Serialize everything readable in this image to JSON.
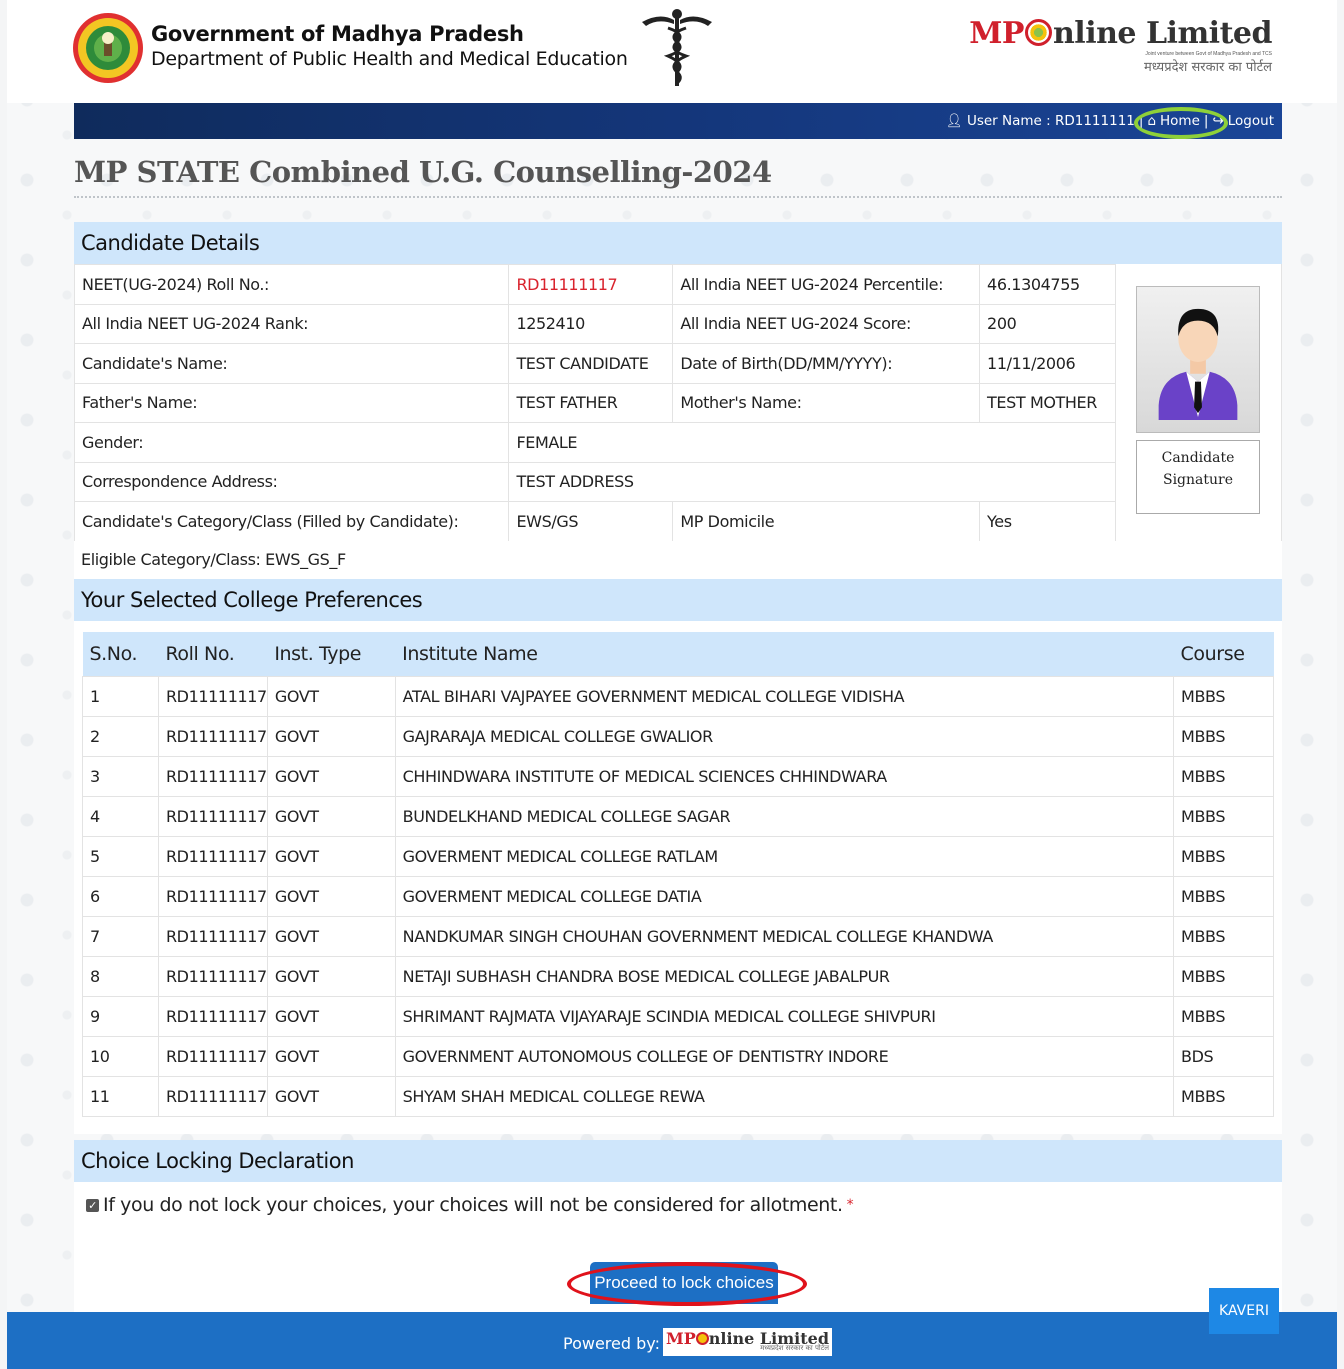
{
  "header": {
    "gov_title": "Government of Madhya Pradesh",
    "dept": "Department of Public Health and Medical Education",
    "mponline_brand_mp": "MP",
    "mponline_brand_rest": "nline Limited",
    "mponline_sub1": "Joint venture between Govt of Madhya Pradesh and TCS",
    "mponline_sub2": "मध्यप्रदेश सरकार का पोर्टल"
  },
  "topbar": {
    "user_label": "User Name : RD1111111",
    "home": "Home",
    "logout": "Logout",
    "separator": "|"
  },
  "page_title": "MP STATE Combined U.G. Counselling-2024",
  "candidate": {
    "heading": "Candidate Details",
    "roll_label": "NEET(UG-2024) Roll No.:",
    "roll_value": "RD11111117",
    "percentile_label": "All India NEET UG-2024 Percentile:",
    "percentile_value": "46.1304755",
    "rank_label": "All India NEET UG-2024 Rank:",
    "rank_value": "1252410",
    "score_label": "All India NEET UG-2024 Score:",
    "score_value": "200",
    "name_label": "Candidate's Name:",
    "name_value": "TEST CANDIDATE",
    "dob_label": "Date of Birth(DD/MM/YYYY):",
    "dob_value": "11/11/2006",
    "father_label": "Father's Name:",
    "father_value": "TEST FATHER",
    "mother_label": "Mother's Name:",
    "mother_value": "TEST MOTHER",
    "gender_label": "Gender:",
    "gender_value": "FEMALE",
    "address_label": "Correspondence Address:",
    "address_value": "TEST ADDRESS",
    "category_label": "Candidate's Category/Class (Filled by Candidate):",
    "category_value": "EWS/GS",
    "domicile_label": "MP Domicile",
    "domicile_value": "Yes",
    "eligible": "Eligible Category/Class: EWS_GS_F",
    "signature_line1": "Candidate",
    "signature_line2": "Signature"
  },
  "preferences": {
    "heading": "Your Selected College Preferences",
    "columns": [
      "S.No.",
      "Roll No.",
      "Inst. Type",
      "Institute Name",
      "Course"
    ],
    "rows": [
      [
        "1",
        "RD11111117",
        "GOVT",
        "ATAL BIHARI VAJPAYEE GOVERNMENT MEDICAL COLLEGE VIDISHA",
        "MBBS"
      ],
      [
        "2",
        "RD11111117",
        "GOVT",
        "GAJRARAJA MEDICAL COLLEGE GWALIOR",
        "MBBS"
      ],
      [
        "3",
        "RD11111117",
        "GOVT",
        "CHHINDWARA INSTITUTE OF MEDICAL SCIENCES CHHINDWARA",
        "MBBS"
      ],
      [
        "4",
        "RD11111117",
        "GOVT",
        "BUNDELKHAND MEDICAL COLLEGE SAGAR",
        "MBBS"
      ],
      [
        "5",
        "RD11111117",
        "GOVT",
        "GOVERMENT MEDICAL COLLEGE RATLAM",
        "MBBS"
      ],
      [
        "6",
        "RD11111117",
        "GOVT",
        "GOVERMENT MEDICAL COLLEGE DATIA",
        "MBBS"
      ],
      [
        "7",
        "RD11111117",
        "GOVT",
        "NANDKUMAR SINGH CHOUHAN GOVERNMENT MEDICAL COLLEGE KHANDWA",
        "MBBS"
      ],
      [
        "8",
        "RD11111117",
        "GOVT",
        "NETAJI SUBHASH CHANDRA BOSE MEDICAL COLLEGE JABALPUR",
        "MBBS"
      ],
      [
        "9",
        "RD11111117",
        "GOVT",
        "SHRIMANT RAJMATA VIJAYARAJE SCINDIA MEDICAL COLLEGE SHIVPURI",
        "MBBS"
      ],
      [
        "10",
        "RD11111117",
        "GOVT",
        "GOVERNMENT AUTONOMOUS COLLEGE OF DENTISTRY INDORE",
        "BDS"
      ],
      [
        "11",
        "RD11111117",
        "GOVT",
        "SHYAM SHAH MEDICAL COLLEGE REWA",
        "MBBS"
      ]
    ]
  },
  "declaration": {
    "heading": "Choice Locking Declaration",
    "text": "If you do not lock your choices, your choices will not be considered for allotment.",
    "required_mark": "*",
    "checked": true,
    "button": "Proceed to lock choices"
  },
  "footer": {
    "powered": "Powered by:",
    "logo_mp": "MP",
    "logo_rest": "nline Limited",
    "logo_sub": "मध्यप्रदेश सरकार का पोर्टल"
  },
  "kaveri": "KAVERI",
  "colors": {
    "navy": "#14367a",
    "panel_header": "#cfe6fb",
    "button_blue": "#1d6fc4",
    "accent_red": "#d9232d",
    "highlight_green": "#8ed039"
  }
}
